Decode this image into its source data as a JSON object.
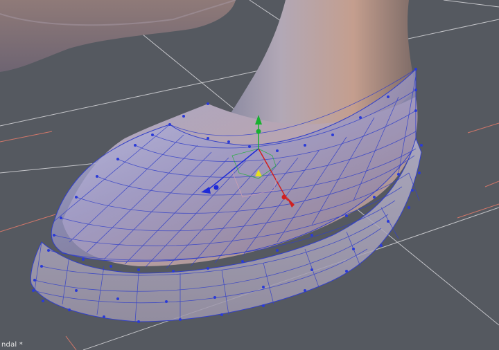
{
  "document": {
    "name": "ndal *"
  },
  "viewport": {
    "background": "#555960",
    "grid_color": "#d8d8dc",
    "axis_color": "#e07a6a",
    "wire_color": "#3340c8",
    "vertex_color": "#2a3ad8"
  },
  "gizmo": {
    "x_color": "#d02020",
    "y_color": "#18b030",
    "z_color": "#1e2ad8",
    "center_color": "#e6e020"
  }
}
